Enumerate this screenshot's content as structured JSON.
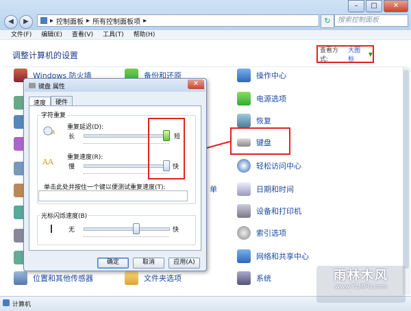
{
  "window": {
    "breadcrumb": [
      "控制面板",
      "所有控制面板项"
    ],
    "search_placeholder": "搜索控制面板",
    "controls": {
      "minimize": "–",
      "maximize": "□",
      "close": "✕"
    }
  },
  "menu": [
    "文件(F)",
    "编辑(E)",
    "查看(V)",
    "工具(T)",
    "帮助(H)"
  ],
  "content": {
    "heading": "调整计算机的设置",
    "view_by_label": "查看方式:",
    "view_by_value": "大图标"
  },
  "items": {
    "firewall": "Windows 防火墙",
    "backup": "备份和还原",
    "action_center": "操作中心",
    "power": "电源选项",
    "recovery": "恢复",
    "keyboard": "键盘",
    "ease_access": "轻松访问中心",
    "datetime": "日期和时间",
    "devices": "设备和打印机",
    "index": "索引选项",
    "network": "网络和共享中心",
    "system": "系统",
    "location": "位置和其他传感器",
    "folder": "文件夹选项",
    "partial_right": "单"
  },
  "dialog": {
    "title": "键盘 属性",
    "tabs": [
      "速度",
      "硬件"
    ],
    "char_repeat": {
      "group": "字符重复",
      "delay_label": "重复延迟(D):",
      "delay_min": "长",
      "delay_max": "短",
      "delay_level": 1.0,
      "rate_label": "重复速度(R):",
      "rate_min": "慢",
      "rate_max": "快",
      "rate_level": 1.0,
      "test_label": "单击此处并按住一个键以便测试重复速度(T):",
      "test_value": ""
    },
    "cursor": {
      "group": "光标闪烁速度(B)",
      "min": "无",
      "max": "快",
      "level": 0.62
    },
    "buttons": {
      "ok": "确定",
      "cancel": "取消",
      "apply": "应用(A)"
    }
  },
  "status": {
    "text": "计算机"
  },
  "watermark": {
    "name": "雨林木风",
    "url": "www.YLMFU.com"
  },
  "colors": {
    "annotation": "#e02020",
    "link": "#1a4aa0"
  }
}
